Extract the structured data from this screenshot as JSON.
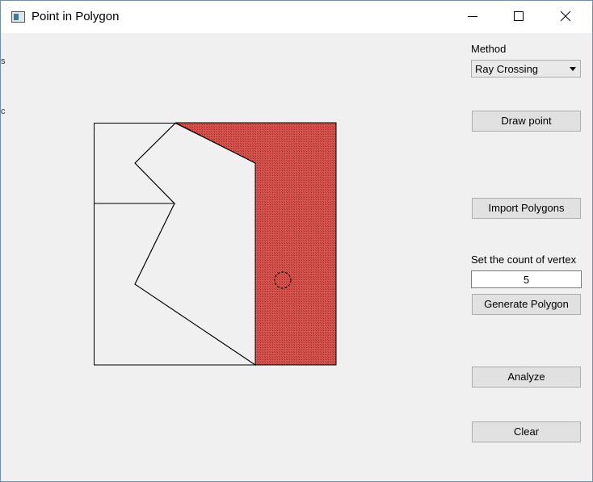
{
  "window": {
    "title": "Point in Polygon",
    "app_icon": "qt-app-icon",
    "controls": {
      "minimize": "minimize-icon",
      "maximize": "maximize-icon",
      "close": "close-icon"
    }
  },
  "panel": {
    "method_label": "Method",
    "method_value": "Ray Crossing",
    "draw_point_label": "Draw point",
    "import_label": "Import Polygons",
    "vertex_count_label": "Set the count of vertex",
    "vertex_count_value": "5",
    "generate_label": "Generate Polygon",
    "analyze_label": "Analyze",
    "clear_label": "Clear"
  },
  "canvas": {
    "highlight_color": "#d9534f",
    "highlighted_polygon": "right-polygon",
    "point_state": "inside-highlighted-polygon"
  },
  "edge_fragments": [
    "s",
    "c"
  ]
}
